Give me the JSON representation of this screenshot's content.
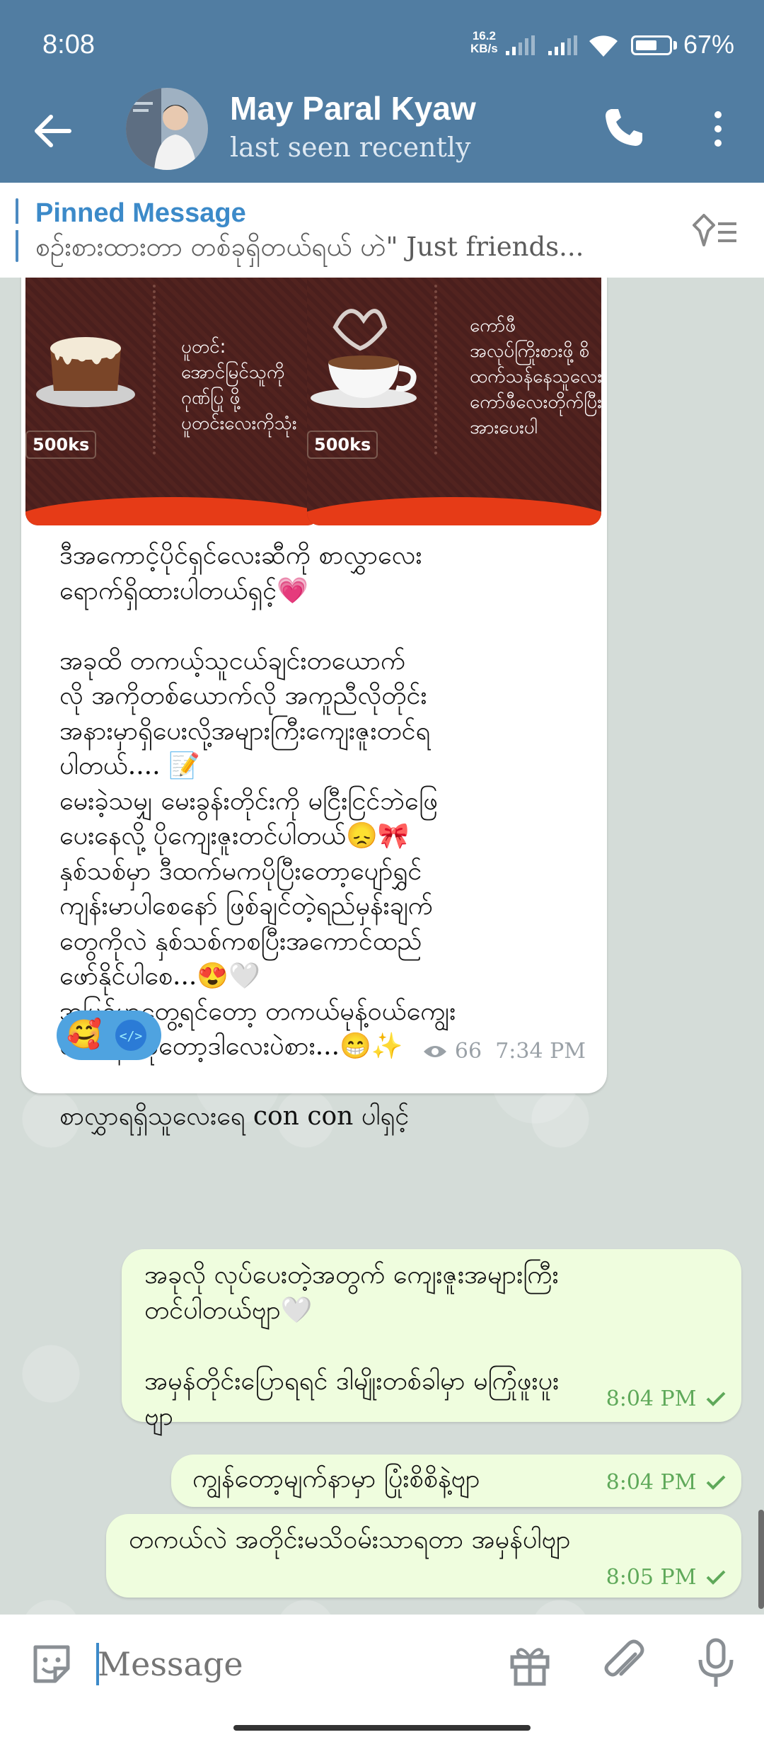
{
  "status": {
    "time": "8:08",
    "speed_value": "16.2",
    "speed_unit": "KB/s",
    "battery": "67%",
    "battery_level": 0.67
  },
  "header": {
    "name": "May Paral Kyaw",
    "subtitle": "last seen recently"
  },
  "pinned": {
    "title": "Pinned Message",
    "text": "စဥ်းစားထားတာ တစ်ခုရှိတယ်ရယ် ဟဲ\" Just friends..."
  },
  "incoming": {
    "image1": {
      "text": "ပူတင်:\nအောင်မြင်သူကို\nဂုဏ်ပြု ဖို့\nပူတင်းလေးကိုသုံး",
      "price": "500ks"
    },
    "image2": {
      "text": "ကော်ဖီ\nအလုပ်ကြိုးစားဖို့ စိ\nထက်သန်နေသူလေး\nကော်ဖီလေးတိုက်ပြီး\nအားပေးပါ",
      "price": "500ks"
    },
    "text": "ဒီအကောင့်ပိုင်ရှင်လေးဆီကို စာလွှာလေး\nရောက်ရှိထားပါတယ်ရှင့်💗\n\nအခုထိ တကယ့်သူငယ်ချင်းတယောက်\nလို အကိုတစ်ယောက်လို အကူညီလိုတိုင်း\nအနားမှာရှိပေးလို့အများကြီးကျေးဇူးတင်ရ\nပါတယ်.... 📝\nမေးခဲ့သမျှ မေးခွန်းတိုင်းကို မငြီးငြင်ဘဲဖြေ\nပေးနေလို့ ပိုကျေးဇူးတင်ပါတယ်😞🎀\nနှစ်သစ်မှာ ဒီထက်မကပိုပြီးတော့ပျော်ရွှင်\nကျန်းမာပါစေနော် ဖြစ်ချင်တဲ့ရည်မှန်းချက်\nတွေကိုလဲ နှစ်သစ်ကစပြီးအကောင်ထည်\nဖော်နိုင်ပါစေ...😍🤍\nအပြင်မှာတွေ့ရင်တော့ တကယ်မုန့်ဝယ်ကျွေး\nမယ်နော် ခုတော့ဒါလေးပဲစား...😁✨\n\nစာလွှာရရှိသူလေးရေ con con ပါရှင့်",
    "reaction_emoji": "🥰",
    "views": "66",
    "time": "7:34 PM"
  },
  "outgoing": [
    {
      "text": "အခုလို လုပ်ပေးတဲ့အတွက် ကျေးဇူးအများကြီး\nတင်ပါတယ်ဗျာ🤍\n\nအမှန်တိုင်းပြောရရင် ဒါမျိုးတစ်ခါမှာ မကြုံဖူးပူး\nဗျာ",
      "time": "8:04 PM"
    },
    {
      "text": "ကျွန်တော့မျက်နာမှာ ပြုံးစိစိနဲ့ဗျာ",
      "time": "8:04 PM"
    },
    {
      "text": "တကယ်လဲ အတိုင်းမသိဝမ်းသာရတာ အမှန်ပါဗျာ",
      "time": "8:05 PM"
    }
  ],
  "input": {
    "placeholder": "Message"
  },
  "colors": {
    "header": "#517da2",
    "outgoing_bubble": "#effdde",
    "accent": "#3c8ac9",
    "check": "#5fa95a"
  }
}
